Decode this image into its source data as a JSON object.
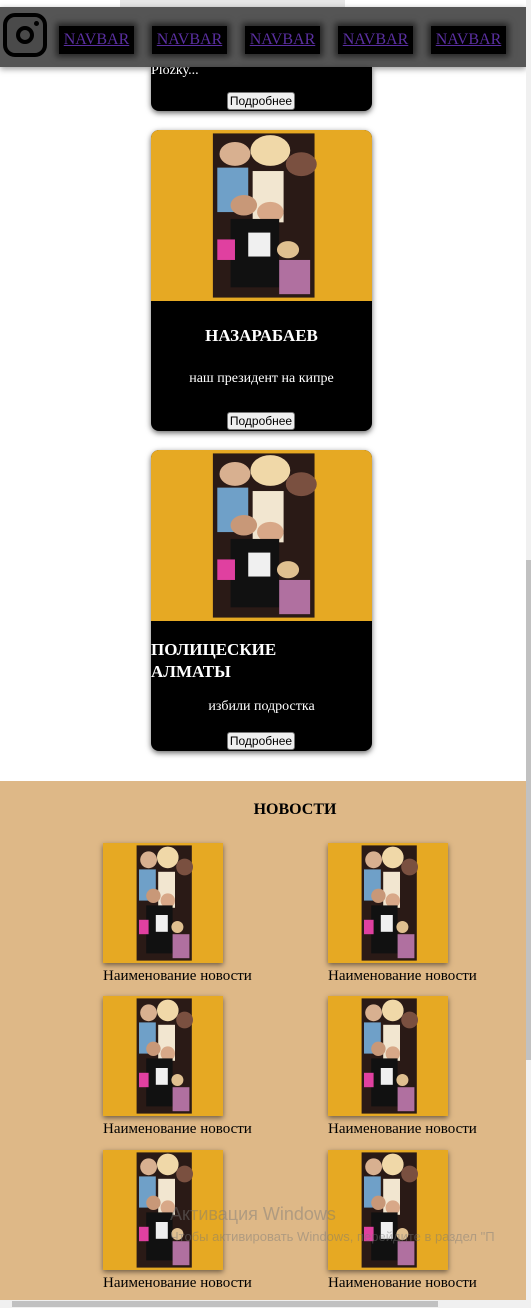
{
  "navbar": {
    "icon": "instagram-icon",
    "items": [
      "NAVBAR",
      "NAVBAR",
      "NAVBAR",
      "NAVBAR",
      "NAVBAR"
    ]
  },
  "cards": [
    {
      "desc": "Рložку...",
      "button": "Подробнее"
    },
    {
      "title": "НАЗАРАБАЕВ",
      "desc": "наш президент на кипре",
      "button": "Подробнее"
    },
    {
      "title": "ПОЛИЦЕСКИЕ АЛМАТЫ",
      "desc": "избили подростка",
      "button": "Подробнее"
    }
  ],
  "news": {
    "title": "НОВОСТИ",
    "items": [
      "Наименование новости",
      "Наименование новости",
      "Наименование новости",
      "Наименование новости",
      "Наименование новости",
      "Наименование новости"
    ]
  },
  "watermark": {
    "line1": "Активация Windows",
    "line2": "Чтобы активировать Windows, перейдите в раздел \"П"
  },
  "colors": {
    "navbar_bg": "#555555",
    "card_bg": "#000000",
    "image_bg": "#e6a923",
    "news_bg": "#deb887",
    "link": "#5a2fa0"
  }
}
